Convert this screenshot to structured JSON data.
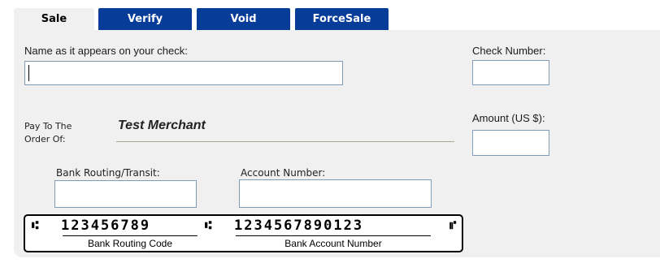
{
  "tabs": [
    {
      "label": "Sale",
      "active": true
    },
    {
      "label": "Verify",
      "active": false
    },
    {
      "label": "Void",
      "active": false
    },
    {
      "label": "ForceSale",
      "active": false
    }
  ],
  "form": {
    "name_label": "Name as it appears on your check:",
    "name_value": "",
    "check_number_label": "Check Number:",
    "check_number_value": "",
    "pay_to_line1": "Pay To The",
    "pay_to_line2": "Order Of:",
    "payee": "Test Merchant",
    "amount_label": "Amount (US $):",
    "amount_value": "",
    "routing_label": "Bank Routing/Transit:",
    "routing_value": "",
    "account_label": "Account Number:",
    "account_value": ""
  },
  "micr": {
    "routing_digits": "123456789",
    "account_digits": "1234567890123",
    "routing_caption": "Bank Routing Code",
    "account_caption": "Bank Account Number",
    "symbol_transit": "⑆",
    "symbol_onus": "⑈"
  },
  "colors": {
    "tab_inactive": "#083c99",
    "panel": "#f0f0f0",
    "input_border": "#7f9db9"
  }
}
